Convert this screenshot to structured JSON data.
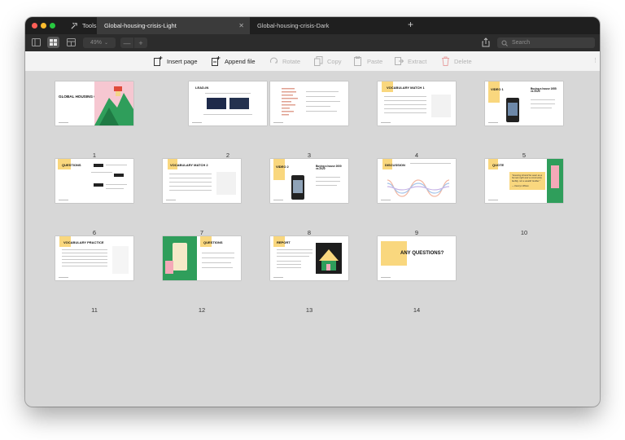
{
  "window": {
    "tools_label": "Tools",
    "tabs": [
      {
        "title": "Global-housing-crisis-Light",
        "active": true
      },
      {
        "title": "Global-housing-crisis-Dark",
        "active": false
      }
    ],
    "new_tab": "+"
  },
  "toolbar": {
    "zoom": "49%",
    "zoom_out": "—",
    "zoom_in": "+",
    "search_placeholder": "Search"
  },
  "actions": [
    {
      "label": "Insert page",
      "enabled": true,
      "icon": "insert-page-icon"
    },
    {
      "label": "Append file",
      "enabled": true,
      "icon": "append-file-icon"
    },
    {
      "label": "Rotate",
      "enabled": false,
      "icon": "rotate-icon"
    },
    {
      "label": "Copy",
      "enabled": false,
      "icon": "copy-icon"
    },
    {
      "label": "Paste",
      "enabled": false,
      "icon": "paste-icon"
    },
    {
      "label": "Extract",
      "enabled": false,
      "icon": "extract-icon"
    },
    {
      "label": "Delete",
      "enabled": false,
      "icon": "trash-icon"
    }
  ],
  "slides": [
    {
      "number": "1",
      "title": "GLOBAL HOUSING CRISIS"
    },
    {
      "number": "2",
      "title": "LEAD-IN"
    },
    {
      "number": "3",
      "title": ""
    },
    {
      "number": "4",
      "title": "VOCABULARY MATCH 1"
    },
    {
      "number": "5",
      "title": "VIDEO 1",
      "subtitle": "Buying a house 1955 vs 2020"
    },
    {
      "number": "6",
      "title": "QUESTIONS"
    },
    {
      "number": "7",
      "title": "VOCABULARY MATCH 2"
    },
    {
      "number": "8",
      "title": "VIDEO 2",
      "subtitle": "Buying a house 2000 vs 2020"
    },
    {
      "number": "9",
      "title": "DISCUSSION"
    },
    {
      "number": "10",
      "title": "QUOTE",
      "quote": "\"Housing should be seen as a human right and a community facility, not a wealth builder.\"",
      "quote_author": "— Kamryn Wilson"
    },
    {
      "number": "11",
      "title": "VOCABULARY PRACTICE"
    },
    {
      "number": "12",
      "title": "QUESTIONS"
    },
    {
      "number": "13",
      "title": "REPORT"
    },
    {
      "number": "14",
      "title": "ANY QUESTIONS?"
    }
  ],
  "colors": {
    "slide_accent_yellow": "#f9d77e",
    "illustration_green": "#2f9e5b",
    "illustration_pink": "#f4a9b8",
    "titlebar": "#1f1f1f"
  }
}
